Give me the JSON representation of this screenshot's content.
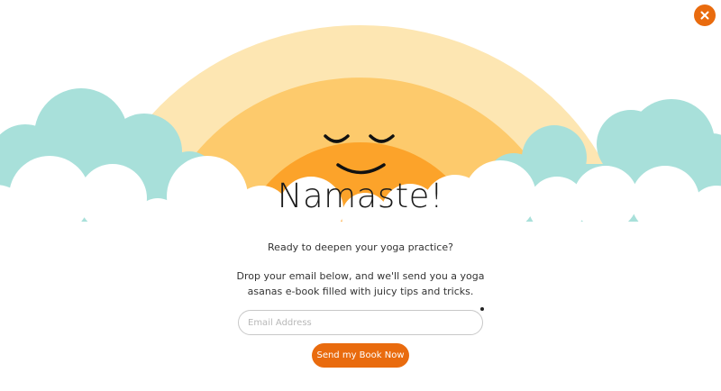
{
  "colors": {
    "accent": "#e96b0e",
    "sun": "#fca32a",
    "arc_inner": "#fdca6c",
    "arc_outer": "#fde6b2",
    "clouds_back": "#a8e0da",
    "clouds_front": "#ffffff",
    "face": "#111111"
  },
  "popup": {
    "close_icon": "close-icon",
    "title": "Namaste!",
    "question": "Ready to deepen your yoga practice?",
    "body_lines": [
      "Drop your email below, and we'll send you a yoga",
      "asanas e-book filled with juicy tips and tricks."
    ],
    "email": {
      "placeholder": "Email Address",
      "value": ""
    },
    "cta_label": "Send my Book Now"
  }
}
